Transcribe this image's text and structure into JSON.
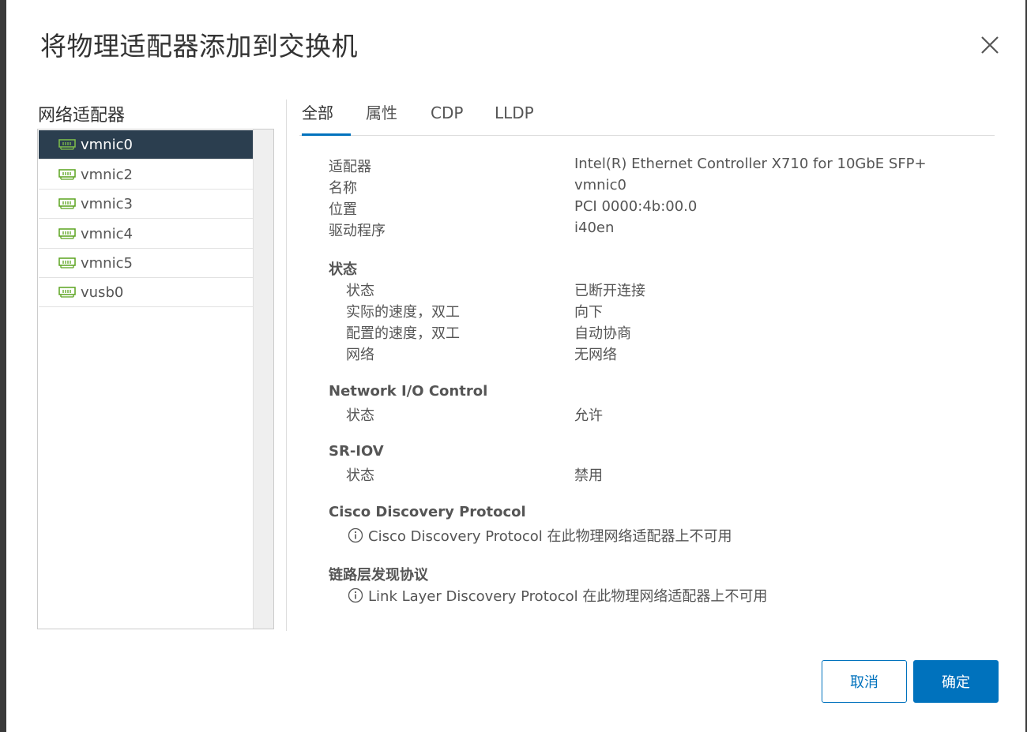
{
  "dialog": {
    "title": "将物理适配器添加到交换机"
  },
  "left": {
    "title": "网络适配器",
    "items": [
      {
        "label": "vmnic0"
      },
      {
        "label": "vmnic2"
      },
      {
        "label": "vmnic3"
      },
      {
        "label": "vmnic4"
      },
      {
        "label": "vmnic5"
      },
      {
        "label": "vusb0"
      }
    ],
    "selected": "vmnic0"
  },
  "tabs": [
    {
      "label": "全部"
    },
    {
      "label": "属性"
    },
    {
      "label": "CDP"
    },
    {
      "label": "LLDP"
    }
  ],
  "details": {
    "adapter_label": "适配器",
    "adapter_value": "Intel(R) Ethernet Controller X710 for 10GbE SFP+",
    "name_label": "名称",
    "name_value": "vmnic0",
    "location_label": "位置",
    "location_value": "PCI 0000:4b:00.0",
    "driver_label": "驱动程序",
    "driver_value": "i40en",
    "status_section": "状态",
    "status_label": "状态",
    "status_value": "已断开连接",
    "actual_speed_label": "实际的速度，双工",
    "actual_speed_value": "向下",
    "config_speed_label": "配置的速度，双工",
    "config_speed_value": "自动协商",
    "network_label": "网络",
    "network_value": "无网络",
    "nioc_section": "Network I/O Control",
    "nioc_status_label": "状态",
    "nioc_status_value": "允许",
    "sriov_section": "SR-IOV",
    "sriov_status_label": "状态",
    "sriov_status_value": "禁用",
    "cdp_section": "Cisco Discovery Protocol",
    "cdp_message": "Cisco Discovery Protocol 在此物理网络适配器上不可用",
    "lldp_section": "链路层发现协议",
    "lldp_message": "Link Layer Discovery Protocol 在此物理网络适配器上不可用"
  },
  "buttons": {
    "cancel": "取消",
    "ok": "确定"
  },
  "colors": {
    "accent": "#0072bd",
    "selected_bg": "#2b3e4f",
    "nic_icon_green": "#5aa31e"
  },
  "icons": {
    "close": "close-icon",
    "nic": "network-adapter-icon",
    "info": "info-icon"
  }
}
